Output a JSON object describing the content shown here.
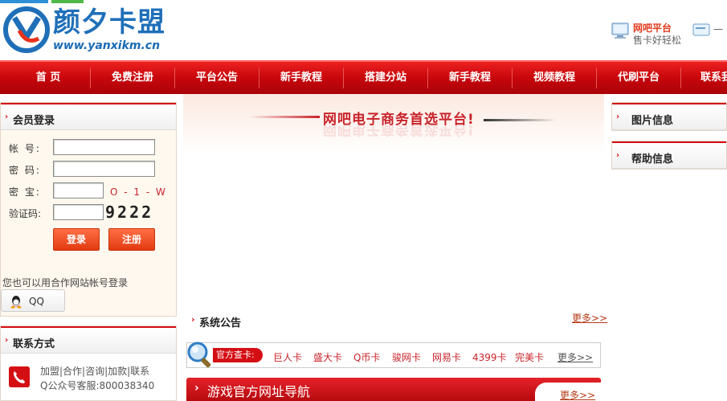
{
  "brand": {
    "name": "颜夕卡盟",
    "url": "www.yanxikm.cn"
  },
  "header_right": {
    "title": "网吧平台",
    "subtitle": "售卡好轻松",
    "extra": "一"
  },
  "nav": {
    "items": [
      "首 页",
      "免费注册",
      "平台公告",
      "新手教程",
      "搭建分站",
      "新手教程",
      "视频教程",
      "代刷平台",
      "联系我"
    ]
  },
  "login": {
    "title": "会员登录",
    "account_label": "帐  号:",
    "password_label": "密  码:",
    "secret_label": "密  宝:",
    "captcha_label": "验证码:",
    "secret_hint": "O - 1 - W",
    "captcha_code": "9222",
    "login_button": "登录",
    "register_button": "注册",
    "alt_login_text": "您也可以用合作网站帐号登录",
    "qq_button": "QQ"
  },
  "contact": {
    "title": "联系方式",
    "line1": "加盟|合作|咨询|加款|联系",
    "line2": "Q公众号客服:800038340"
  },
  "slogan": "网吧电子商务首选平台!",
  "notice": {
    "title": "系统公告",
    "more": "更多>>"
  },
  "cards": {
    "tag": "官方查卡:",
    "links": [
      "巨人卡",
      "盛大卡",
      "Q币卡",
      "骏网卡",
      "网易卡",
      "4399卡",
      "完美卡"
    ],
    "more": "更多>>"
  },
  "game_nav": {
    "title": "游戏官方网址导航",
    "more": "更多>>"
  },
  "right_boxes": {
    "image_info": "图片信息",
    "help_info": "帮助信息"
  },
  "colors": {
    "primary_red": "#d40f14",
    "brand_blue": "#1f6fb8",
    "link_red": "#c8242b"
  }
}
